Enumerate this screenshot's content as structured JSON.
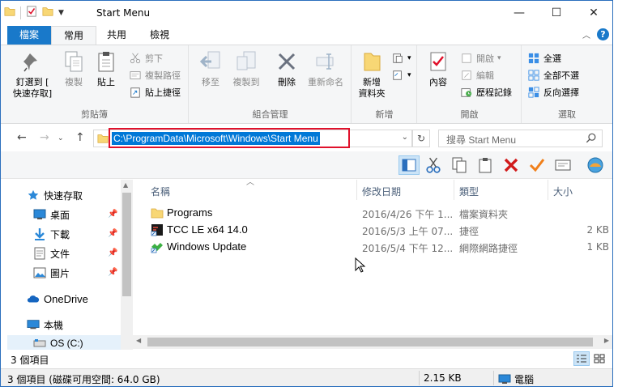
{
  "window": {
    "title": "Start Menu",
    "buttons": {
      "minimize": "—",
      "maximize": "☐",
      "close": "✕"
    }
  },
  "ribbon_tabs": [
    {
      "label": "檔案"
    },
    {
      "label": "常用"
    },
    {
      "label": "共用"
    },
    {
      "label": "檢視"
    }
  ],
  "ribbon_groups": {
    "clipboard": {
      "label": "剪貼簿",
      "pin": "釘選到 [\n快速存取]",
      "copy": "複製",
      "paste": "貼上",
      "cut": "剪下",
      "copy_path": "複製路徑",
      "paste_shortcut": "貼上捷徑"
    },
    "organize": {
      "label": "組合管理",
      "move_to": "移至",
      "copy_to": "複製到",
      "delete": "刪除",
      "rename": "重新命名"
    },
    "new": {
      "label": "新增",
      "new_folder": "新增\n資料夾"
    },
    "open": {
      "label": "開啟",
      "properties": "內容",
      "open": "開啟",
      "edit": "編輯",
      "history": "歷程記錄"
    },
    "select": {
      "label": "選取",
      "select_all": "全選",
      "select_none": "全部不選",
      "invert": "反向選擇"
    }
  },
  "address": {
    "path": "C:\\ProgramData\\Microsoft\\Windows\\Start Menu",
    "search_placeholder": "搜尋 Start Menu"
  },
  "nav_pane": [
    {
      "label": "快速存取",
      "icon": "star-icon"
    },
    {
      "label": "桌面",
      "icon": "desktop-icon",
      "pinned": true
    },
    {
      "label": "下載",
      "icon": "download-icon",
      "pinned": true
    },
    {
      "label": "文件",
      "icon": "documents-icon",
      "pinned": true
    },
    {
      "label": "圖片",
      "icon": "pictures-icon",
      "pinned": true
    },
    {
      "label": "OneDrive",
      "icon": "cloud-icon"
    },
    {
      "label": "本機",
      "icon": "pc-icon"
    },
    {
      "label": "OS (C:)",
      "icon": "drive-icon"
    }
  ],
  "columns": {
    "name": "名稱",
    "date": "修改日期",
    "type": "類型",
    "size": "大小"
  },
  "files": [
    {
      "name": "Programs",
      "date": "2016/4/26 下午 1...",
      "type": "檔案資料夾",
      "size": "",
      "icon": "folder-icon"
    },
    {
      "name": "TCC LE x64 14.0",
      "date": "2016/5/3 上午 07...",
      "type": "捷徑",
      "size": "2 KB",
      "icon": "app-shortcut-icon"
    },
    {
      "name": "Windows Update",
      "date": "2016/5/4 下午 12...",
      "type": "網際網路捷徑",
      "size": "1 KB",
      "icon": "internet-shortcut-icon"
    }
  ],
  "status": {
    "item_count": "3 個項目",
    "outer_items": "3 個項目 (磁碟可用空間: 64.0 GB)",
    "outer_size": "2.15 KB",
    "outer_location": "電腦"
  },
  "colors": {
    "accent": "#1979ca",
    "selection": "#0078d7",
    "highlight_box": "#e0112b"
  }
}
